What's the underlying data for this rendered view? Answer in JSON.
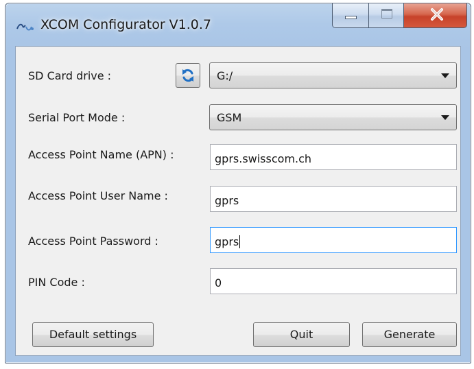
{
  "window": {
    "title": "XCOM Configurator V1.0.7"
  },
  "caption": {
    "minimize_icon": "minimize-icon",
    "maximize_icon": "maximize-icon",
    "close_icon": "close-icon"
  },
  "form": {
    "sd_card": {
      "label": "SD Card drive :",
      "value": "G:/",
      "refresh_icon": "refresh-icon"
    },
    "serial_port_mode": {
      "label": "Serial Port Mode :",
      "value": "GSM"
    },
    "apn": {
      "label": "Access Point Name (APN) :",
      "value": "gprs.swisscom.ch"
    },
    "apn_user": {
      "label": "Access Point User Name :",
      "value": "gprs"
    },
    "apn_password": {
      "label": "Access Point Password :",
      "value": "gprs"
    },
    "pin_code": {
      "label": "PIN Code :",
      "value": "0"
    }
  },
  "buttons": {
    "default_settings": "Default settings",
    "quit": "Quit",
    "generate": "Generate"
  },
  "colors": {
    "titlebar": "#aec9e8",
    "close_button": "#c7422a",
    "focus_border": "#3399ff",
    "refresh_icon": "#1f6fc4"
  }
}
